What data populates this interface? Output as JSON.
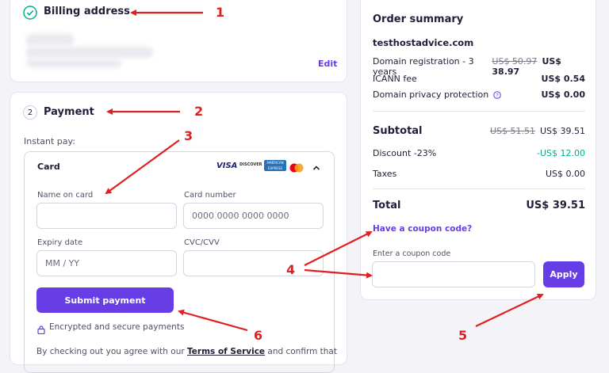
{
  "billing": {
    "step_title": "Billing address",
    "edit_label": "Edit"
  },
  "payment": {
    "step_number": "2",
    "step_title": "Payment",
    "instant_pay_label": "Instant pay:",
    "card_label": "Card",
    "card_brands": [
      "VISA",
      "DISCOVER",
      "AMERICAN EXPRESS",
      "MASTERCARD"
    ],
    "name_label": "Name on card",
    "name_value": "",
    "number_label": "Card number",
    "number_placeholder": "0000 0000 0000 0000",
    "expiry_label": "Expiry date",
    "expiry_placeholder": "MM / YY",
    "cvc_label": "CVC/CVV",
    "cvc_value": "",
    "submit_label": "Submit payment",
    "secure_label": "Encrypted and secure payments",
    "terms_prefix": "By checking out you agree with our ",
    "terms_link": "Terms of Service",
    "terms_suffix": " and confirm that"
  },
  "order": {
    "title": "Order summary",
    "domain": "testhostadvice.com",
    "lines": [
      {
        "label": "Domain registration - 3 years",
        "old": "US$ 50.97",
        "price": "US$ 38.97"
      },
      {
        "label": "ICANN fee",
        "old": "",
        "price": "US$ 0.54"
      },
      {
        "label": "Domain privacy protection",
        "old": "",
        "price": "US$ 0.00"
      }
    ],
    "subtotal_label": "Subtotal",
    "subtotal_old": "US$ 51.51",
    "subtotal_value": "US$ 39.51",
    "discount_label": "Discount -23%",
    "discount_value": "-US$ 12.00",
    "taxes_label": "Taxes",
    "taxes_value": "US$ 0.00",
    "total_label": "Total",
    "total_value": "US$ 39.51",
    "coupon_link": "Have a coupon code?",
    "coupon_label": "Enter a coupon code",
    "coupon_value": "",
    "apply_label": "Apply"
  },
  "annotations": [
    "1",
    "2",
    "3",
    "4",
    "5",
    "6"
  ],
  "colors": {
    "accent": "#673de6",
    "annotation": "#e02020",
    "discount": "#00b090"
  }
}
